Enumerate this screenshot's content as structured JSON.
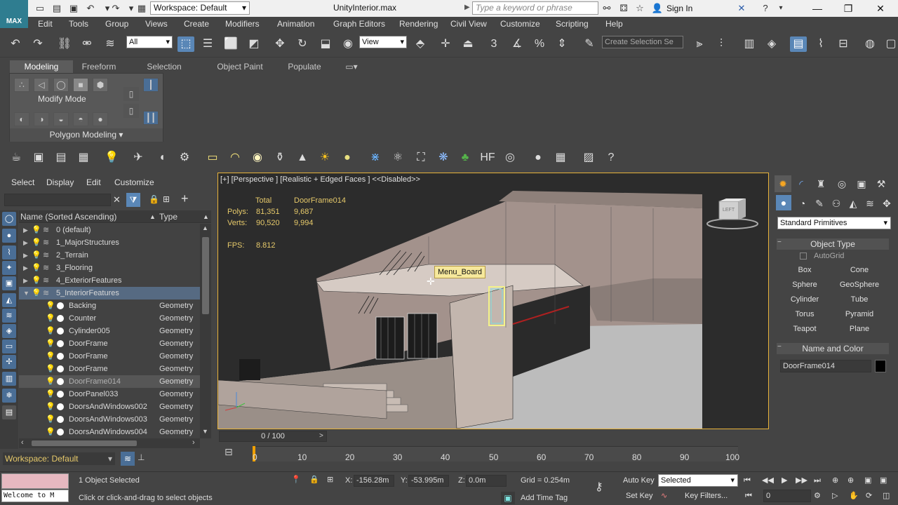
{
  "titlebar": {
    "logo_text": "MAX",
    "workspace_label": "Workspace: Default",
    "title": "UnityInterior.max",
    "search_placeholder": "Type a keyword or phrase",
    "sign_in": "Sign In"
  },
  "menu": [
    "Edit",
    "Tools",
    "Group",
    "Views",
    "Create",
    "Modifiers",
    "Animation",
    "Graph Editors",
    "Rendering",
    "Civil View",
    "Customize",
    "Scripting",
    "Help"
  ],
  "toolbar": {
    "selection_filter": "All",
    "ref_coord": "View",
    "create_selection_set": "Create Selection Se"
  },
  "ribbon": {
    "tabs": [
      "Modeling",
      "Freeform",
      "Selection",
      "Object Paint",
      "Populate"
    ],
    "modify_mode": "Modify Mode",
    "polygon_modeling": "Polygon Modeling"
  },
  "explorer": {
    "menus": [
      "Select",
      "Display",
      "Edit",
      "Customize"
    ],
    "col_name": "Name (Sorted Ascending)",
    "col_type": "Type",
    "rows": [
      {
        "name": "0 (default)",
        "type": ""
      },
      {
        "name": "1_MajorStructures",
        "type": ""
      },
      {
        "name": "2_Terrain",
        "type": ""
      },
      {
        "name": "3_Flooring",
        "type": ""
      },
      {
        "name": "4_ExteriorFeatures",
        "type": ""
      },
      {
        "name": "5_InteriorFeatures",
        "type": ""
      },
      {
        "name": "Backing",
        "type": "Geometry"
      },
      {
        "name": "Counter",
        "type": "Geometry"
      },
      {
        "name": "Cylinder005",
        "type": "Geometry"
      },
      {
        "name": "DoorFrame",
        "type": "Geometry"
      },
      {
        "name": "DoorFrame",
        "type": "Geometry"
      },
      {
        "name": "DoorFrame",
        "type": "Geometry"
      },
      {
        "name": "DoorFrame014",
        "type": "Geometry"
      },
      {
        "name": "DoorPanel033",
        "type": "Geometry"
      },
      {
        "name": "DoorsAndWindows002",
        "type": "Geometry"
      },
      {
        "name": "DoorsAndWindows003",
        "type": "Geometry"
      },
      {
        "name": "DoorsAndWindows004",
        "type": "Geometry"
      }
    ],
    "workspace": "Workspace: Default"
  },
  "viewport": {
    "label": "[+] [Perspective ] [Realistic + Edged Faces ]  <<Disabled>>",
    "stats_total": "Total",
    "stats_object": "DoorFrame014",
    "polys_label": "Polys:",
    "polys_total": "81,351",
    "polys_obj": "9,687",
    "verts_label": "Verts:",
    "verts_total": "90,520",
    "verts_obj": "9,994",
    "fps_label": "FPS:",
    "fps_value": "8.812",
    "tooltip": "Menu_Board",
    "viewcube_label": "LEFT"
  },
  "cmdpanel": {
    "dropdown": "Standard Primitives",
    "object_type": "Object Type",
    "autogrid": "AutoGrid",
    "buttons": [
      "Box",
      "Cone",
      "Sphere",
      "GeoSphere",
      "Cylinder",
      "Tube",
      "Torus",
      "Pyramid",
      "Teapot",
      "Plane"
    ],
    "name_color": "Name and Color",
    "name_value": "DoorFrame014"
  },
  "timeline": {
    "slider": "0 / 100",
    "ticks": [
      "0",
      "10",
      "20",
      "30",
      "40",
      "50",
      "60",
      "70",
      "80",
      "90",
      "100"
    ]
  },
  "status": {
    "welcome": "Welcome to M",
    "selected": "1 Object Selected",
    "prompt": "Click or click-and-drag to select objects",
    "x_label": "X:",
    "x": "-156.28m",
    "y_label": "Y:",
    "y": "-53.995m",
    "z_label": "Z:",
    "z": "0.0m",
    "grid": "Grid = 0.254m",
    "add_time_tag": "Add Time Tag",
    "auto_key": "Auto Key",
    "auto_key_mode": "Selected",
    "set_key": "Set Key",
    "key_filters": "Key Filters...",
    "frame": "0"
  }
}
